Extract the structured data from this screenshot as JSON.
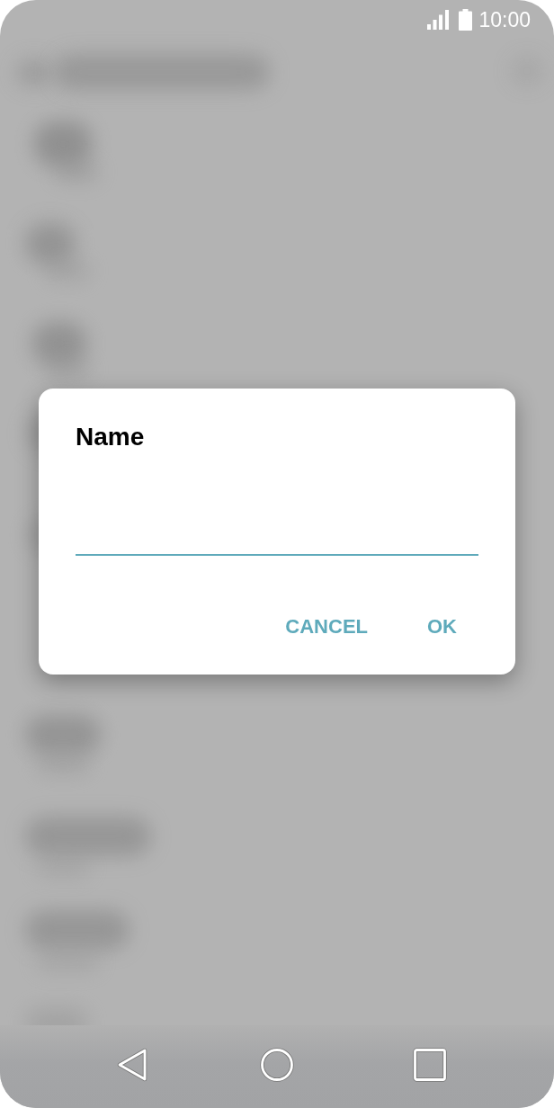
{
  "status_bar": {
    "time": "10:00"
  },
  "dialog": {
    "title": "Name",
    "field": {
      "focused": true
    },
    "buttons": [
      "CANCEL",
      "OK"
    ]
  }
}
